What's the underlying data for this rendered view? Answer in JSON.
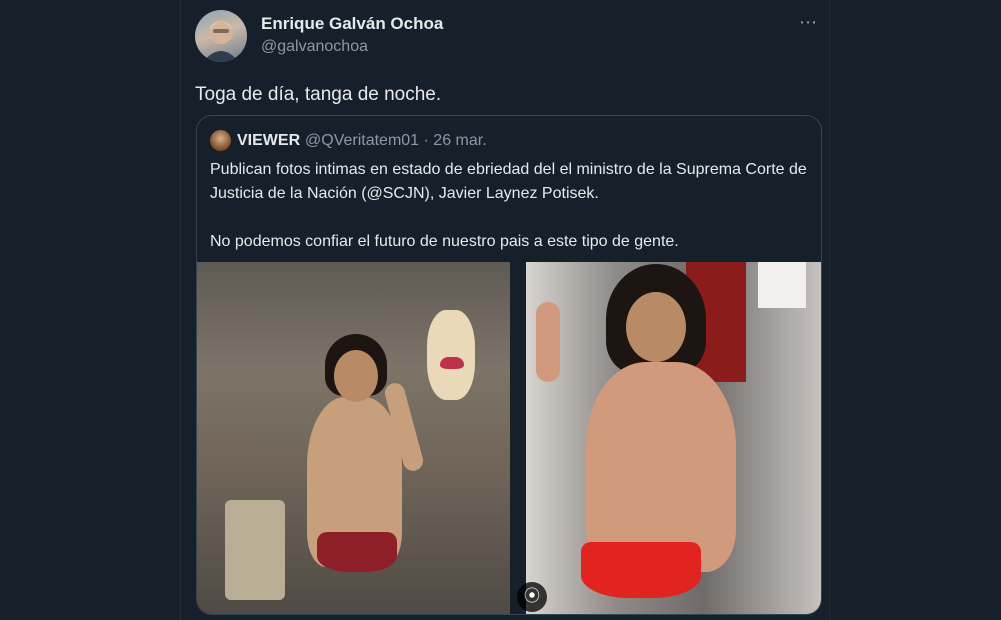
{
  "tweet": {
    "author_name": "Enrique Galván Ochoa",
    "author_handle": "@galvanochoa",
    "text": "Toga de día, tanga de noche.",
    "more_icon": "⋯"
  },
  "quote": {
    "author_name": "VIEWER",
    "author_handle": "@QVeritatem01 · 26 mar.",
    "text_1": "Publican fotos intimas en estado de ebriedad del el ministro de la Suprema Corte de Justicia de la Nación (@SCJN), Javier Laynez Potisek.",
    "text_2": "No podemos confiar el futuro de nuestro pais a este tipo de gente."
  },
  "media": {
    "button_icon": "⦿"
  },
  "colors": {
    "background": "#15202b",
    "text": "#e7e9ea",
    "secondary": "#8b98a5",
    "border": "#38444d"
  }
}
